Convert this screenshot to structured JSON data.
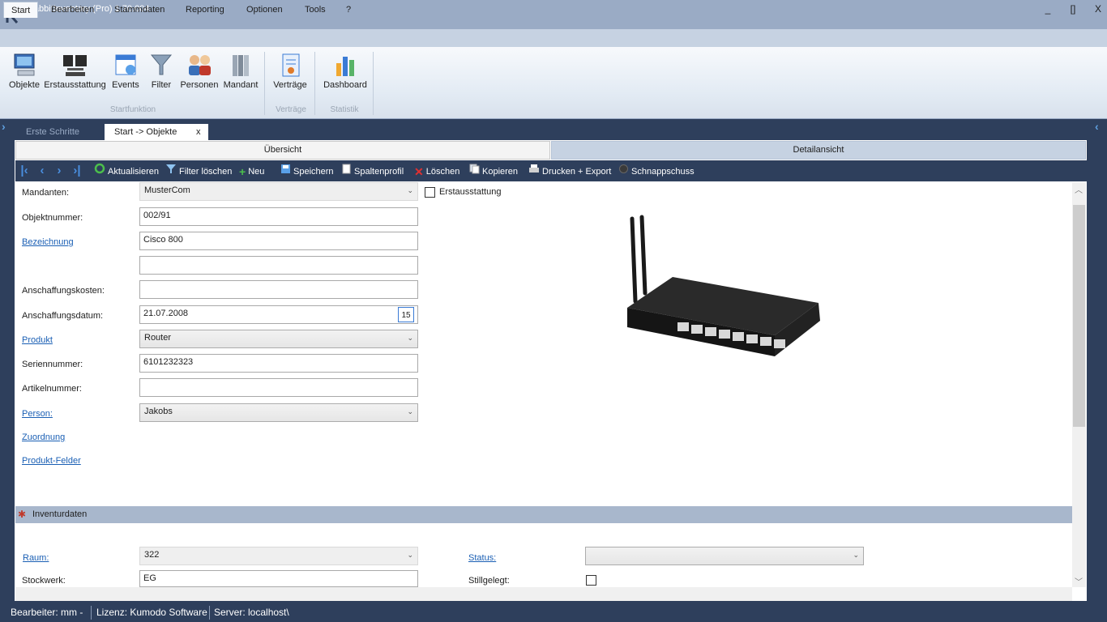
{
  "app": {
    "title": "RabbitInventory (Pro) 1.70.004",
    "minimize": "_",
    "maximize": "[]",
    "close": "X"
  },
  "menu": [
    "Start",
    "Bearbeiten",
    "Stammdaten",
    "Reporting",
    "Optionen",
    "Tools",
    "?"
  ],
  "ribbon": {
    "buttons": [
      "Objekte",
      "Erstausstattung",
      "Events",
      "Filter",
      "Personen",
      "Mandant",
      "Verträge",
      "Dashboard"
    ],
    "groups": [
      "Startfunktion",
      "Verträge",
      "Statistik"
    ]
  },
  "doc_tabs": {
    "first": "Erste Schritte",
    "active": "Start -> Objekte",
    "close": "x"
  },
  "view_tabs": {
    "overview": "Übersicht",
    "detail": "Detailansicht"
  },
  "toolbar": [
    "Aktualisieren",
    "Filter löschen",
    "Neu",
    "Speichern",
    "Spaltenprofil",
    "Löschen",
    "Kopieren",
    "Drucken + Export",
    "Schnappschuss"
  ],
  "form": {
    "mandanten_label": "Mandanten:",
    "mandanten_value": "MusterCom",
    "erstausstattung_label": "Erstausstattung",
    "objektnummer_label": "Objektnummer:",
    "objektnummer_value": "002/91",
    "bezeichnung_label": "Bezeichnung",
    "bezeichnung_value": "Cisco 800",
    "bezeichnung2_value": "",
    "anschaffungskosten_label": "Anschaffungskosten:",
    "anschaffungskosten_value": "",
    "anschaffungsdatum_label": "Anschaffungsdatum:",
    "anschaffungsdatum_value": "21.07.2008",
    "calendar_day": "15",
    "produkt_label": "Produkt",
    "produkt_value": "Router",
    "seriennummer_label": "Seriennummer:",
    "seriennummer_value": "6101232323",
    "artikelnummer_label": "Artikelnummer:",
    "artikelnummer_value": "",
    "person_label": "Person:",
    "person_value": "Jakobs",
    "zuordnung_label": "Zuordnung",
    "produktfelder_label": "Produkt-Felder"
  },
  "inventur": {
    "section_title": "Inventurdaten",
    "raum_label": "Raum:",
    "raum_value": "322",
    "stockwerk_label": "Stockwerk:",
    "stockwerk_value": "EG",
    "status_label": "Status:",
    "status_value": "",
    "stillgelegt_label": "Stillgelegt:"
  },
  "status": {
    "bearbeiter": "Bearbeiter: mm -",
    "lizenz": "Lizenz: Kumodo Software",
    "server": "Server: localhost\\"
  },
  "colors": {
    "accent": "#2e3f5c",
    "title": "#9aabc5",
    "link": "#1a5fb4"
  }
}
